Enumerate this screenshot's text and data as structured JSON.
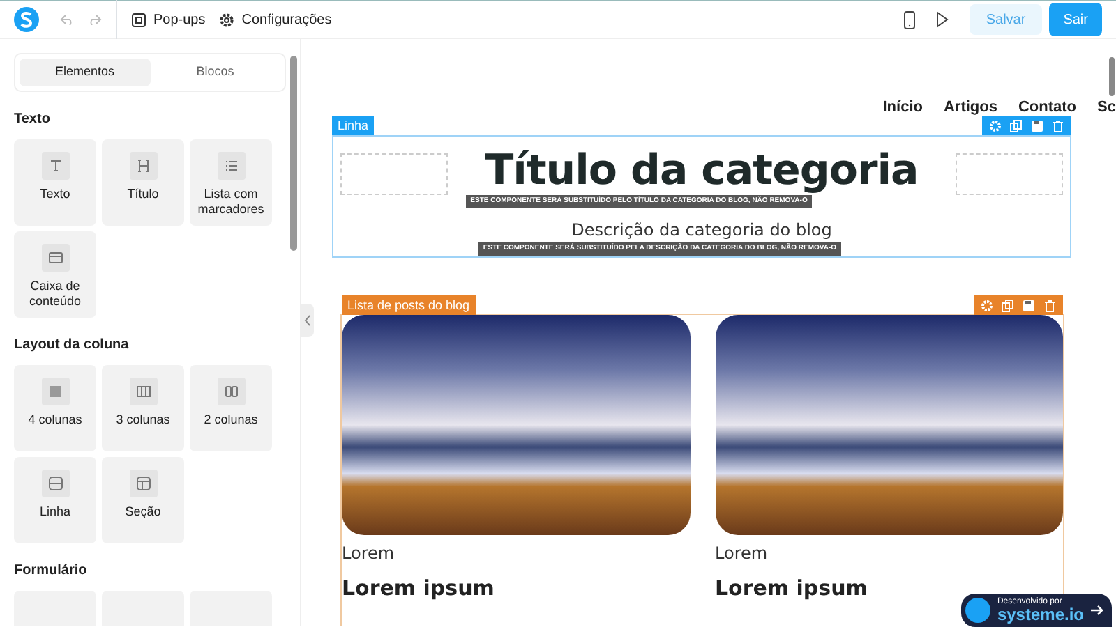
{
  "toolbar": {
    "items": [
      {
        "label": "Pop-ups",
        "kind": "popups"
      },
      {
        "label": "Configurações",
        "kind": "settings"
      }
    ],
    "save_button": "Salvar",
    "exit_button": "Sair"
  },
  "sidebar": {
    "tabs": [
      {
        "label": "Elementos",
        "selected": true
      },
      {
        "label": "Blocos",
        "selected": false
      }
    ],
    "sections": [
      {
        "title": "Texto",
        "items": [
          {
            "label": "Texto",
            "kind": "text"
          },
          {
            "label": "Título",
            "kind": "heading"
          },
          {
            "label": "Lista com marcadores",
            "kind": "list"
          },
          {
            "label": "Caixa de conteúdo",
            "kind": "box"
          }
        ]
      },
      {
        "title": "Layout da coluna",
        "items": [
          {
            "label": "4 colunas",
            "kind": "col4"
          },
          {
            "label": "3 colunas",
            "kind": "col3"
          },
          {
            "label": "2 colunas",
            "kind": "col2"
          },
          {
            "label": "Linha",
            "kind": "row"
          },
          {
            "label": "Seção",
            "kind": "section"
          }
        ]
      },
      {
        "title": "Formulário"
      }
    ]
  },
  "canvas": {
    "nav": [
      "Início",
      "Artigos",
      "Contato",
      "Sc"
    ],
    "row": {
      "label": "Linha",
      "title": "Título da categoria",
      "title_note": "ESTE COMPONENTE SERÁ SUBSTITUÍDO PELO TÍTULO DA CATEGORIA DO BLOG, NÃO REMOVA-O",
      "description": "Descrição da categoria do blog",
      "description_note": "ESTE COMPONENTE SERÁ SUBSTITUÍDO PELA DESCRIÇÃO DA CATEGORIA DO BLOG, NÃO REMOVA-O"
    },
    "posts": {
      "label": "Lista de posts do blog",
      "items": [
        {
          "category": "Lorem",
          "title": "Lorem ipsum"
        },
        {
          "category": "Lorem",
          "title": "Lorem ipsum"
        }
      ]
    }
  },
  "badge": {
    "caption": "Desenvolvido por",
    "brand": "systeme.io"
  }
}
